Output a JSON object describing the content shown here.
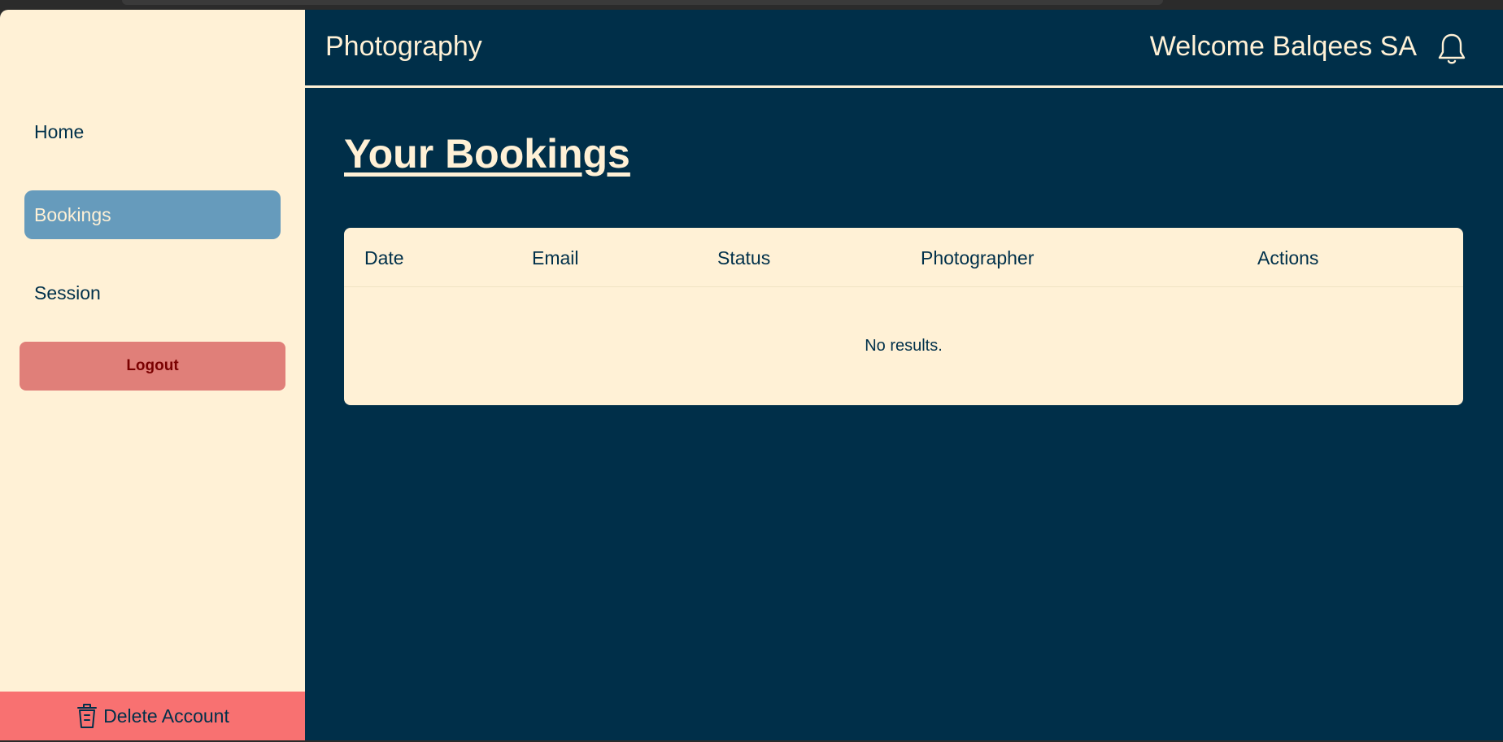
{
  "sidebar": {
    "items": [
      {
        "label": "Home",
        "active": false
      },
      {
        "label": "Bookings",
        "active": true
      },
      {
        "label": "Session",
        "active": false
      }
    ],
    "logout_label": "Logout",
    "delete_label": "Delete Account"
  },
  "header": {
    "title": "Photography",
    "welcome": "Welcome Balqees SA"
  },
  "main": {
    "page_title": "Your Bookings",
    "table": {
      "columns": [
        "Date",
        "Email",
        "Status",
        "Photographer",
        "Actions"
      ],
      "empty_message": "No results."
    }
  },
  "icons": {
    "bell": "bell-icon",
    "trash": "trash-icon"
  },
  "colors": {
    "sidebar_bg": "#fff1d6",
    "main_bg": "#002f49",
    "active_nav": "#669bbc",
    "logout_bg": "#e07f79",
    "delete_bg": "#f87171"
  }
}
